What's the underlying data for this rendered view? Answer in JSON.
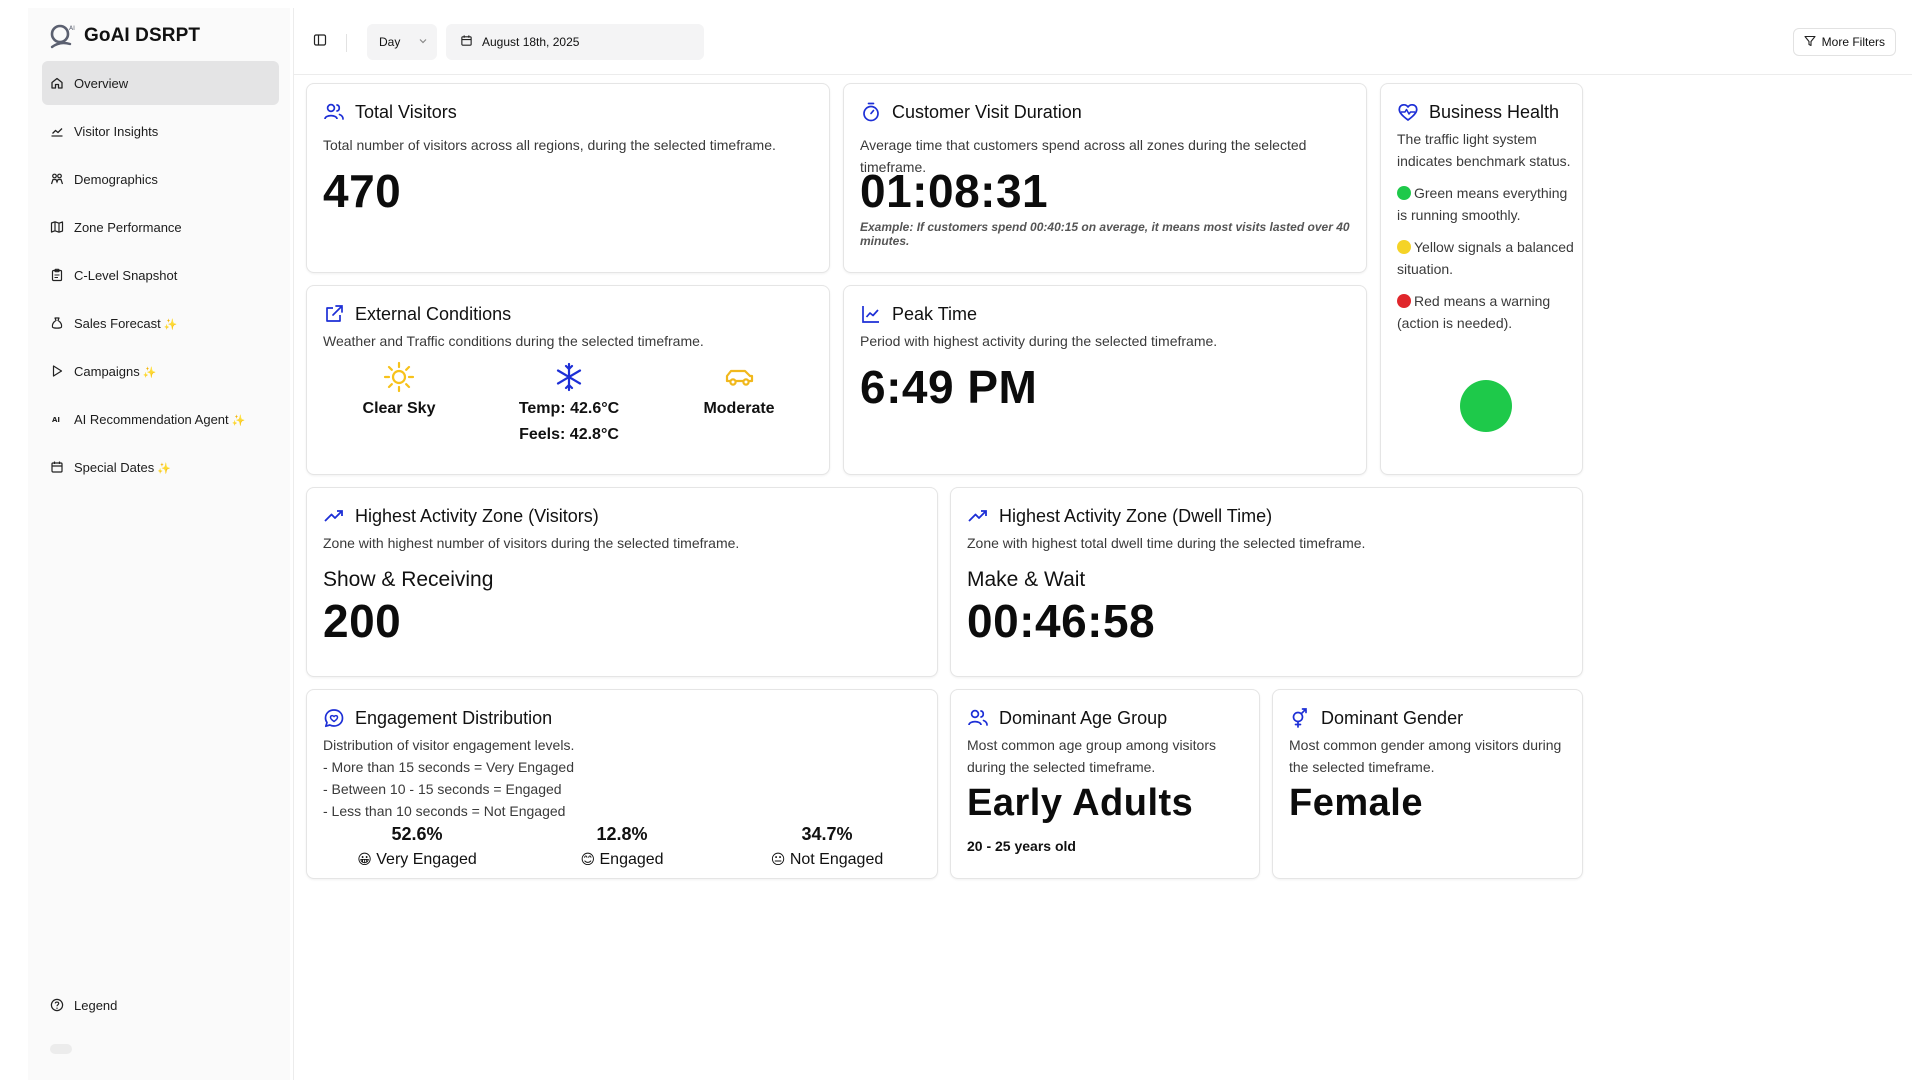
{
  "sidebar": {
    "brand": "GoAI DSRPT",
    "items": [
      {
        "label": "Overview",
        "icon": "home-icon",
        "sparkle": ""
      },
      {
        "label": "Visitor Insights",
        "icon": "trend-icon",
        "sparkle": ""
      },
      {
        "label": "Demographics",
        "icon": "people-icon",
        "sparkle": ""
      },
      {
        "label": "Zone Performance",
        "icon": "map-icon",
        "sparkle": ""
      },
      {
        "label": "C-Level Snapshot",
        "icon": "clipboard-icon",
        "sparkle": ""
      },
      {
        "label": "Sales Forecast",
        "icon": "moneybag-icon",
        "sparkle": "✨"
      },
      {
        "label": "Campaigns",
        "icon": "play-icon",
        "sparkle": "✨"
      },
      {
        "label": "AI Recommendation Agent",
        "icon": "ai-icon",
        "sparkle": "✨"
      },
      {
        "label": "Special Dates",
        "icon": "calendar-icon",
        "sparkle": "✨"
      }
    ],
    "legend": "Legend"
  },
  "topbar": {
    "period": "Day",
    "date": "August 18th, 2025",
    "filters": "More Filters"
  },
  "cards": {
    "total_visitors": {
      "title": "Total Visitors",
      "desc": "Total number of visitors across all regions, during the selected timeframe.",
      "value": "470"
    },
    "visit_duration": {
      "title": "Customer Visit Duration",
      "desc": "Average time that customers spend across all zones during the selected timeframe.",
      "value": "01:08:31",
      "note": "Example: If customers spend 00:40:15 on average, it means most visits lasted over 40 minutes."
    },
    "business_health": {
      "title": "Business Health",
      "intro": "The traffic light system indicates benchmark status.",
      "green": "Green means everything is running smoothly.",
      "yellow": "Yellow signals a balanced situation.",
      "red": "Red means a warning (action is needed).",
      "status_color": "#1ec94a"
    },
    "external": {
      "title": "External Conditions",
      "desc": "Weather and Traffic conditions during the selected timeframe.",
      "sky": "Clear Sky",
      "temp": "Temp: 42.6°C",
      "feels": "Feels: 42.8°C",
      "traffic": "Moderate"
    },
    "peak_time": {
      "title": "Peak Time",
      "desc": "Period with highest activity during the selected timeframe.",
      "value": "6:49 PM"
    },
    "zone_visitors": {
      "title": "Highest Activity Zone (Visitors)",
      "desc": "Zone with highest number of visitors during the selected timeframe.",
      "zone": "Show & Receiving",
      "value": "200"
    },
    "zone_dwell": {
      "title": "Highest Activity Zone (Dwell Time)",
      "desc": "Zone with highest total dwell time during the selected timeframe.",
      "zone": "Make & Wait",
      "value": "00:46:58"
    },
    "engagement": {
      "title": "Engagement Distribution",
      "desc_lines": [
        "Distribution of visitor engagement levels.",
        "- More than 15 seconds = Very Engaged",
        "- Between 10 - 15 seconds = Engaged",
        "- Less than 10 seconds = Not Engaged"
      ],
      "levels": [
        {
          "pct": "52.6%",
          "emoji": "😀",
          "label": "Very Engaged"
        },
        {
          "pct": "12.8%",
          "emoji": "😊",
          "label": "Engaged"
        },
        {
          "pct": "34.7%",
          "emoji": "😐",
          "label": "Not Engaged"
        }
      ]
    },
    "age_group": {
      "title": "Dominant Age Group",
      "desc": "Most common age group among visitors during the selected timeframe.",
      "value": "Early Adults",
      "range": "20 - 25 years old"
    },
    "gender": {
      "title": "Dominant Gender",
      "desc": "Most common gender among visitors during the selected timeframe.",
      "value": "Female"
    }
  },
  "colors": {
    "accent": "#1d2fd6",
    "green": "#1ec94a",
    "yellow": "#f5d327",
    "red": "#e0262b",
    "sun": "#f7c21b",
    "car": "#f1b81c"
  }
}
